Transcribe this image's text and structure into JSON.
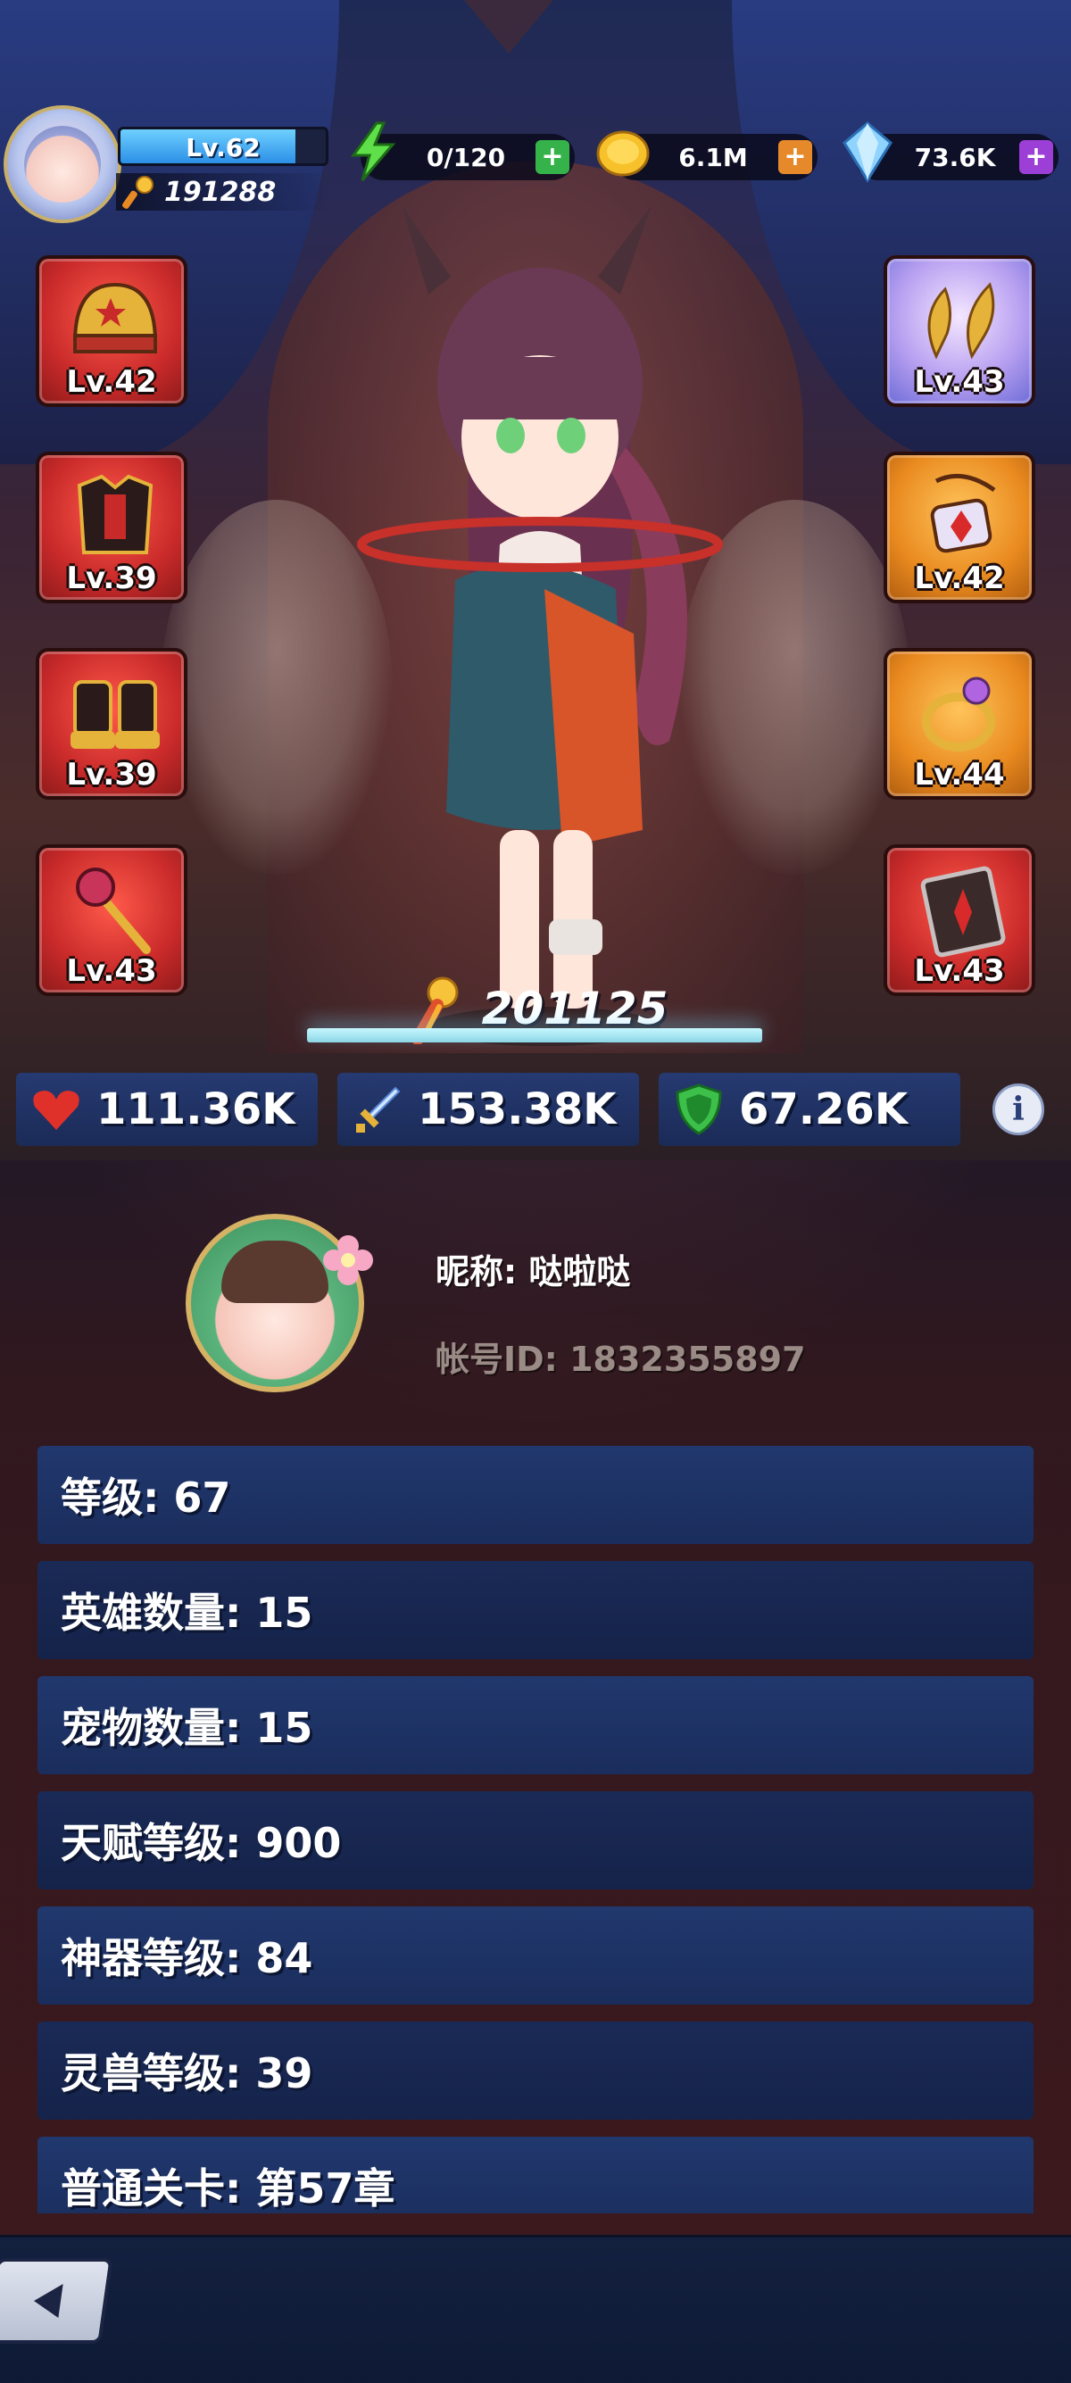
{
  "header": {
    "player_level": "Lv.62",
    "player_level_progress": 0.85,
    "player_power": "191288",
    "energy": "0/120",
    "gold": "6.1M",
    "gems": "73.6K"
  },
  "equipment": {
    "left": [
      {
        "name": "helmet",
        "level": "Lv.42",
        "rarity": "red"
      },
      {
        "name": "armor",
        "level": "Lv.39",
        "rarity": "red"
      },
      {
        "name": "boots",
        "level": "Lv.39",
        "rarity": "red"
      },
      {
        "name": "staff",
        "level": "Lv.43",
        "rarity": "red"
      }
    ],
    "right": [
      {
        "name": "wings",
        "level": "Lv.43",
        "rarity": "purple"
      },
      {
        "name": "necklace",
        "level": "Lv.42",
        "rarity": "orange"
      },
      {
        "name": "ring",
        "level": "Lv.44",
        "rarity": "orange"
      },
      {
        "name": "book",
        "level": "Lv.43",
        "rarity": "red"
      }
    ]
  },
  "hero": {
    "power": "201125"
  },
  "stats": {
    "hp": "111.36K",
    "attack": "153.38K",
    "defense": "67.26K"
  },
  "profile": {
    "nickname": "昵称: 哒啦哒",
    "account_id": "帐号ID: 1832355897"
  },
  "rows": [
    "等级: 67",
    "英雄数量: 15",
    "宠物数量: 15",
    "天赋等级: 900",
    "神器等级: 84",
    "灵兽等级: 39",
    "普通关卡: 第57章"
  ],
  "colors": {
    "row_blue": "#21386e",
    "stat_bar": "#263a72",
    "energy_plus": "#35b34a",
    "gold_plus": "#e6892a",
    "gem_plus": "#9b3fd6"
  }
}
